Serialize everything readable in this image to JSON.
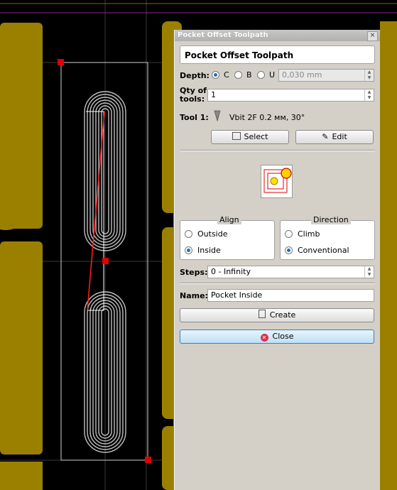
{
  "dialog": {
    "window_title": "Pocket Offset Toolpath",
    "close_glyph": "×",
    "header": "Pocket Offset Toolpath",
    "depth": {
      "label": "Depth:",
      "options": [
        "C",
        "B",
        "U"
      ],
      "selected": "C",
      "value": "0,030 mm"
    },
    "qty": {
      "label": "Qty of tools:",
      "value": "1"
    },
    "tool": {
      "label": "Tool 1:",
      "name": "Vbit 2F 0.2 мм, 30°",
      "select_label": "Select",
      "edit_label": "Edit"
    },
    "align": {
      "title": "Align",
      "options": [
        "Outside",
        "Inside"
      ],
      "selected": "Inside"
    },
    "direction": {
      "title": "Direction",
      "options": [
        "Climb",
        "Conventional"
      ],
      "selected": "Conventional"
    },
    "steps": {
      "label": "Steps:",
      "value": "0 - Infinity"
    },
    "name": {
      "label": "Name:",
      "value": "Pocket Inside"
    },
    "create_label": "Create",
    "close_label": "Close"
  },
  "colors": {
    "copper": "#9b8000",
    "canvas": "#000000",
    "toolpath": "#c0c0c0",
    "handle": "#e00000",
    "accent": "#2a6bb0"
  }
}
